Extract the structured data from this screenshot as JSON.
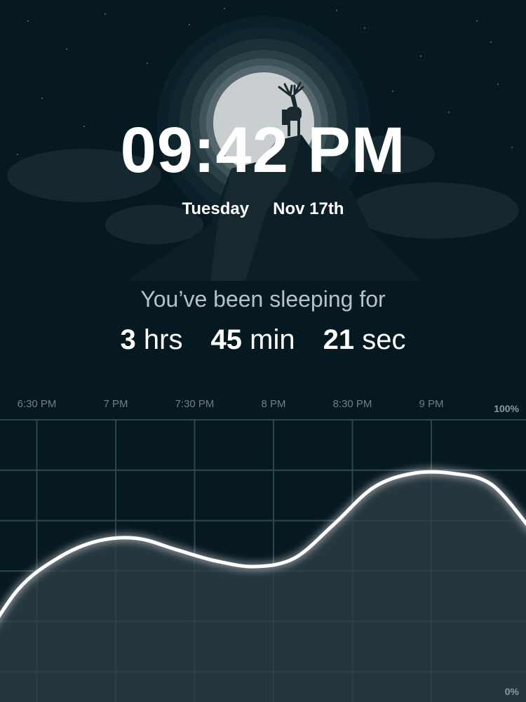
{
  "clock": {
    "time": "09:42 PM",
    "day": "Tuesday",
    "date": "Nov 17th"
  },
  "sleep": {
    "caption": "You’ve been sleeping for",
    "hours": "3",
    "hours_unit": "hrs",
    "minutes": "45",
    "minutes_unit": "min",
    "seconds": "21",
    "seconds_unit": "sec"
  },
  "hero": {
    "illustration": "moon-deer-mountain",
    "icon_name": "deer-icon"
  },
  "colors": {
    "background": "#061820",
    "grid": "#2f444c",
    "area_fill": "#293a40",
    "curve": "#ffffff",
    "axis_text": "#6f7f86",
    "percent_text": "#8a9aa1"
  },
  "chart_data": {
    "type": "area",
    "x_ticks": [
      "6:30 PM",
      "7 PM",
      "7:30 PM",
      "8 PM",
      "8:30 PM",
      "9 PM"
    ],
    "y_top_label": "100%",
    "y_bottom_label": "0%",
    "ylim": [
      0,
      100
    ],
    "grid": true,
    "x": [
      "6:00 PM",
      "6:15 PM",
      "6:30 PM",
      "6:45 PM",
      "7 PM",
      "7:15 PM",
      "7:30 PM",
      "7:45 PM",
      "8 PM",
      "8:15 PM",
      "8:30 PM",
      "8:45 PM",
      "9 PM",
      "9:15 PM",
      "9:30 PM"
    ],
    "values": [
      19,
      40,
      51,
      57,
      58,
      54,
      50,
      48,
      51,
      63,
      76,
      81,
      81,
      77,
      61
    ]
  }
}
